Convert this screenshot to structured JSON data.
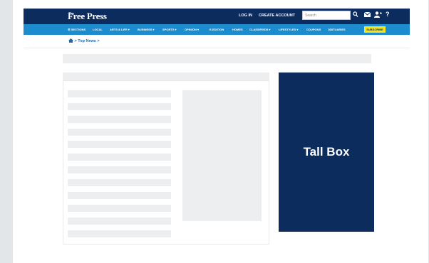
{
  "header": {
    "logo_small": "The",
    "logo": "Free Press",
    "login": "LOG IN",
    "create_account": "CREATE ACCOUNT",
    "search_placeholder": "Search"
  },
  "nav": {
    "items": [
      "☰ SECTIONS",
      "LOCAL",
      "ARTS & LIFE ▾",
      "BUSINESS ▾",
      "SPORTS ▾",
      "OPINION ▾",
      "E-EDITION",
      "HOMES",
      "CLASSIFIEDS ▾",
      "LIFESTYLES ▾",
      "COUPONS",
      "OBITUARIES"
    ],
    "subscribe": "SUBSCRIBE"
  },
  "breadcrumb": "> Top News >",
  "tall_box": "Tall Box",
  "colors": {
    "navy": "#0c2c5e",
    "accent_blue": "#1c8ccf",
    "subscribe_yellow": "#f5e31c"
  }
}
